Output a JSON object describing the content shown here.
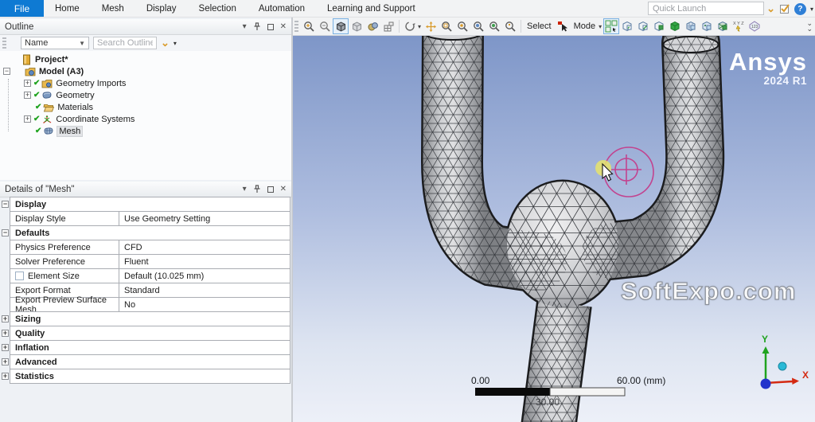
{
  "menubar": {
    "file": "File",
    "items": [
      "Home",
      "Mesh",
      "Display",
      "Selection",
      "Automation",
      "Learning and Support"
    ],
    "quick_launch_placeholder": "Quick Launch",
    "icons": [
      "chevron-down",
      "checklist",
      "help"
    ]
  },
  "outline_panel": {
    "title": "Outline",
    "name_filter": "Name",
    "search_placeholder": "Search Outline",
    "title_icons": [
      "chevron-down",
      "pin",
      "maximize",
      "close"
    ],
    "tree": {
      "project": "Project*",
      "model": "Model (A3)",
      "items": [
        "Geometry Imports",
        "Geometry",
        "Materials",
        "Coordinate Systems",
        "Mesh"
      ],
      "selected_item": "Mesh"
    }
  },
  "details_panel": {
    "title": "Details of \"Mesh\"",
    "sections": [
      {
        "header": "Display",
        "expanded": true,
        "rows": [
          {
            "label": "Display Style",
            "value": "Use Geometry Setting"
          }
        ]
      },
      {
        "header": "Defaults",
        "expanded": true,
        "rows": [
          {
            "label": "Physics Preference",
            "value": "CFD"
          },
          {
            "label": "Solver Preference",
            "value": "Fluent"
          },
          {
            "label": "Element Size",
            "value": "Default (10.025 mm)",
            "checkbox": "unchecked"
          },
          {
            "label": "Export Format",
            "value": "Standard"
          },
          {
            "label": "Export Preview Surface Mesh",
            "value": "No"
          }
        ]
      },
      {
        "header": "Sizing",
        "expanded": false
      },
      {
        "header": "Quality",
        "expanded": false
      },
      {
        "header": "Inflation",
        "expanded": false
      },
      {
        "header": "Advanced",
        "expanded": false
      },
      {
        "header": "Statistics",
        "expanded": false
      }
    ]
  },
  "gfx_toolbar": {
    "select_label": "Select",
    "mode_label": "Mode",
    "icons": [
      "zoom-in-magnifier",
      "zoom-out-magnifier",
      "shaded-cube",
      "wireframe-cube",
      "display-style-cube",
      "viewports-grid",
      "rotate",
      "pan",
      "box-zoom",
      "zoom-magnifier",
      "fit-view-magnifier",
      "zoom-prev-magnifier",
      "zoom-next-magnifier",
      "select-cursor",
      "label-filter-grid",
      "vertex-filter-cube",
      "edge-filter-cube",
      "face-filter-cube",
      "body-filter-cube",
      "mesh-filter-cube",
      "node-filter-cube",
      "element-filter-cube",
      "select-by-id-xyz",
      "annotation-tag",
      "collapse-chevron"
    ]
  },
  "viewport": {
    "logo": "Ansys",
    "version": "2024 R1",
    "watermark": "SoftExpo.com",
    "ruler": {
      "start": "0.00",
      "mid": "30.00",
      "end": "60.00 (mm)"
    },
    "triad": {
      "x": "X",
      "y": "Y"
    }
  },
  "colors": {
    "accent_blue": "#0e7ad3",
    "check_green": "#1fa31f",
    "rotate_cursor_magenta": "#c2438f",
    "viewport_sky_top": "#7e96c8",
    "viewport_sky_bottom": "#edf0f8",
    "triad_x_red": "#d42a12",
    "triad_y_green": "#1fa31f",
    "triad_origin_blue": "#2233cc"
  }
}
